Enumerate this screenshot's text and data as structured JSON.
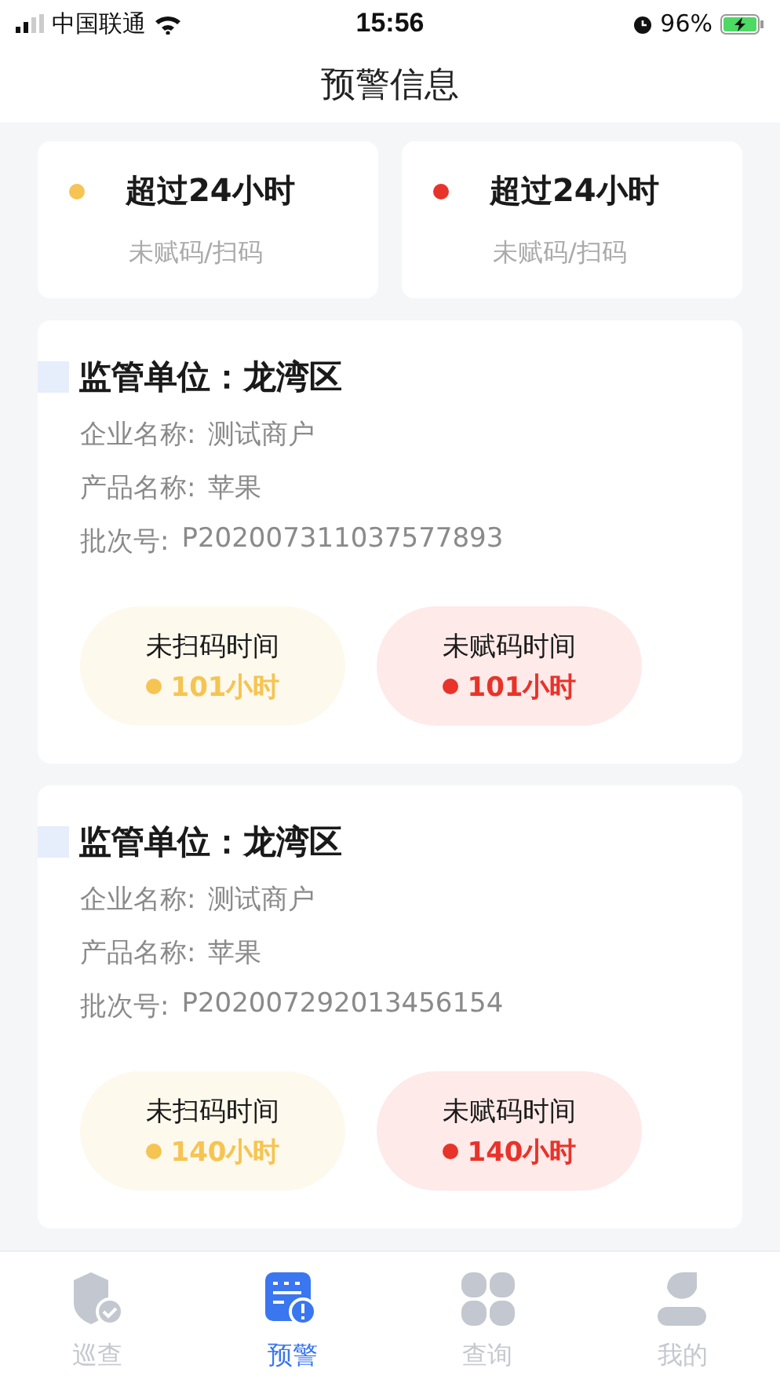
{
  "status_bar": {
    "carrier": "中国联通",
    "time": "15:56",
    "battery": "96%"
  },
  "header": {
    "title": "预警信息"
  },
  "summary": [
    {
      "title": "超过24小时",
      "subtitle": "未赋码/扫码",
      "color": "#f5c452"
    },
    {
      "title": "超过24小时",
      "subtitle": "未赋码/扫码",
      "color": "#e8332a"
    }
  ],
  "alerts": [
    {
      "title": "监管单位：龙湾区",
      "fields": [
        {
          "label": "企业名称:",
          "value": "测试商户"
        },
        {
          "label": "产品名称:",
          "value": "苹果"
        },
        {
          "label": "批次号:",
          "value": "P202007311037577893"
        }
      ],
      "pills": [
        {
          "label": "未扫码时间",
          "value": "101小时",
          "color": "#f5c452"
        },
        {
          "label": "未赋码时间",
          "value": "101小时",
          "color": "#e8332a"
        }
      ]
    },
    {
      "title": "监管单位：龙湾区",
      "fields": [
        {
          "label": "企业名称:",
          "value": "测试商户"
        },
        {
          "label": "产品名称:",
          "value": "苹果"
        },
        {
          "label": "批次号:",
          "value": "P202007292013456154"
        }
      ],
      "pills": [
        {
          "label": "未扫码时间",
          "value": "140小时",
          "color": "#f5c452"
        },
        {
          "label": "未赋码时间",
          "value": "140小时",
          "color": "#e8332a"
        }
      ]
    }
  ],
  "tabs": [
    {
      "label": "巡查",
      "kind": "shield",
      "selected": false
    },
    {
      "label": "预警",
      "kind": "alert",
      "selected": true
    },
    {
      "label": "查询",
      "kind": "grid",
      "selected": false
    },
    {
      "label": "我的",
      "kind": "person",
      "selected": false
    }
  ]
}
